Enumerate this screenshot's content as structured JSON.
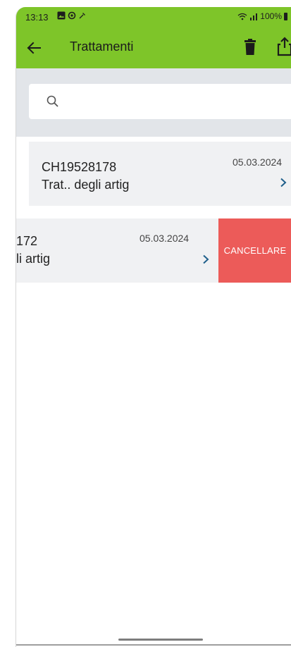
{
  "status_bar": {
    "time": "13:13",
    "battery_text": "100%"
  },
  "app_bar": {
    "title": "Trattamenti"
  },
  "search": {
    "placeholder": "",
    "value": ""
  },
  "items": [
    {
      "code": "CH19528178",
      "description": "Trat.. degli artig",
      "date": "05.03.2024"
    },
    {
      "code": "172",
      "description": "li artig",
      "date": "05.03.2024",
      "swipe_action": "CANCELLARE"
    }
  ],
  "colors": {
    "header_green": "#7ec529",
    "delete_red": "#ec5b59",
    "chevron_blue": "#1f5f8b"
  },
  "icons": [
    "arrow-back-icon",
    "trash-icon",
    "share-icon",
    "search-icon",
    "chevron-right-icon"
  ]
}
